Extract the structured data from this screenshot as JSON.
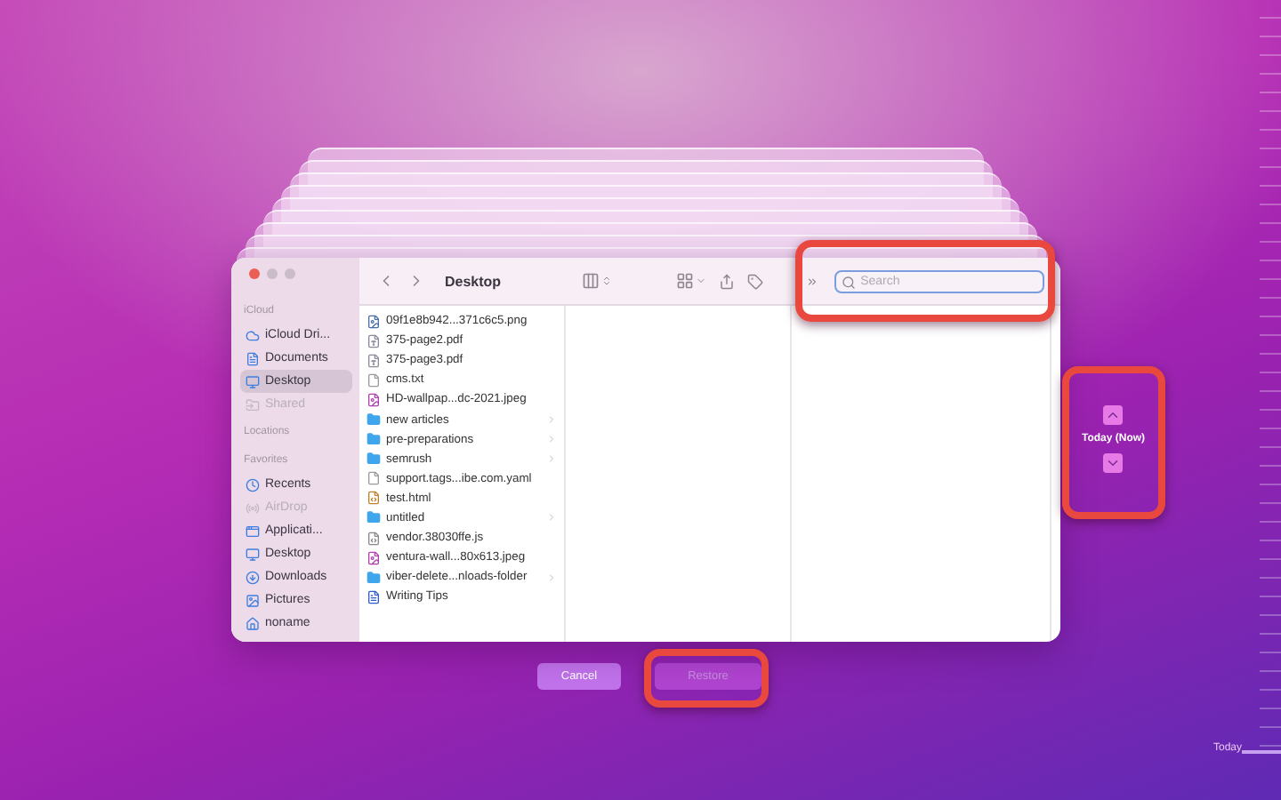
{
  "finder": {
    "title": "Desktop",
    "search": {
      "placeholder": "Search",
      "focused": true
    },
    "sidebar": [
      {
        "heading": "iCloud",
        "items": [
          {
            "label": "iCloud Dri...",
            "kind": "cloud",
            "selected": false,
            "disabled": false
          },
          {
            "label": "Documents",
            "kind": "document",
            "selected": false,
            "disabled": false
          },
          {
            "label": "Desktop",
            "kind": "desktop",
            "selected": true,
            "disabled": false
          },
          {
            "label": "Shared",
            "kind": "shared",
            "selected": false,
            "disabled": true
          }
        ]
      },
      {
        "heading": "Locations"
      },
      {
        "heading": "Favorites",
        "items": [
          {
            "label": "Recents",
            "kind": "recents",
            "selected": false,
            "disabled": false
          },
          {
            "label": "AirDrop",
            "kind": "airdrop",
            "selected": false,
            "disabled": true
          },
          {
            "label": "Applicati...",
            "kind": "apps",
            "selected": false,
            "disabled": false
          },
          {
            "label": "Desktop",
            "kind": "desktop",
            "selected": false,
            "disabled": false
          },
          {
            "label": "Downloads",
            "kind": "downloads",
            "selected": false,
            "disabled": false
          },
          {
            "label": "Pictures",
            "kind": "pictures",
            "selected": false,
            "disabled": false
          },
          {
            "label": "noname",
            "kind": "home",
            "selected": false,
            "disabled": false
          }
        ]
      }
    ],
    "files": [
      {
        "name": "09f1e8b942...371c6c5.png",
        "kind": "image"
      },
      {
        "name": "375-page2.pdf",
        "kind": "pdf"
      },
      {
        "name": "375-page3.pdf",
        "kind": "pdf"
      },
      {
        "name": "cms.txt",
        "kind": "text"
      },
      {
        "name": "HD-wallpap...dc-2021.jpeg",
        "kind": "photo"
      },
      {
        "name": "new articles",
        "kind": "folder"
      },
      {
        "name": "pre-preparations",
        "kind": "folder"
      },
      {
        "name": "semrush",
        "kind": "folder"
      },
      {
        "name": "support.tags...ibe.com.yaml",
        "kind": "text"
      },
      {
        "name": "test.html",
        "kind": "code"
      },
      {
        "name": "untitled",
        "kind": "folder"
      },
      {
        "name": "vendor.38030ffe.js",
        "kind": "script"
      },
      {
        "name": "ventura-wall...80x613.jpeg",
        "kind": "photo"
      },
      {
        "name": "viber-delete...nloads-folder",
        "kind": "folder"
      },
      {
        "name": "Writing Tips",
        "kind": "doc"
      }
    ]
  },
  "timeline": {
    "label": "Today (Now)",
    "scale_label": "Today"
  },
  "buttons": [
    {
      "label": "Cancel",
      "disabled": false
    },
    {
      "label": "Restore",
      "disabled": true
    }
  ]
}
